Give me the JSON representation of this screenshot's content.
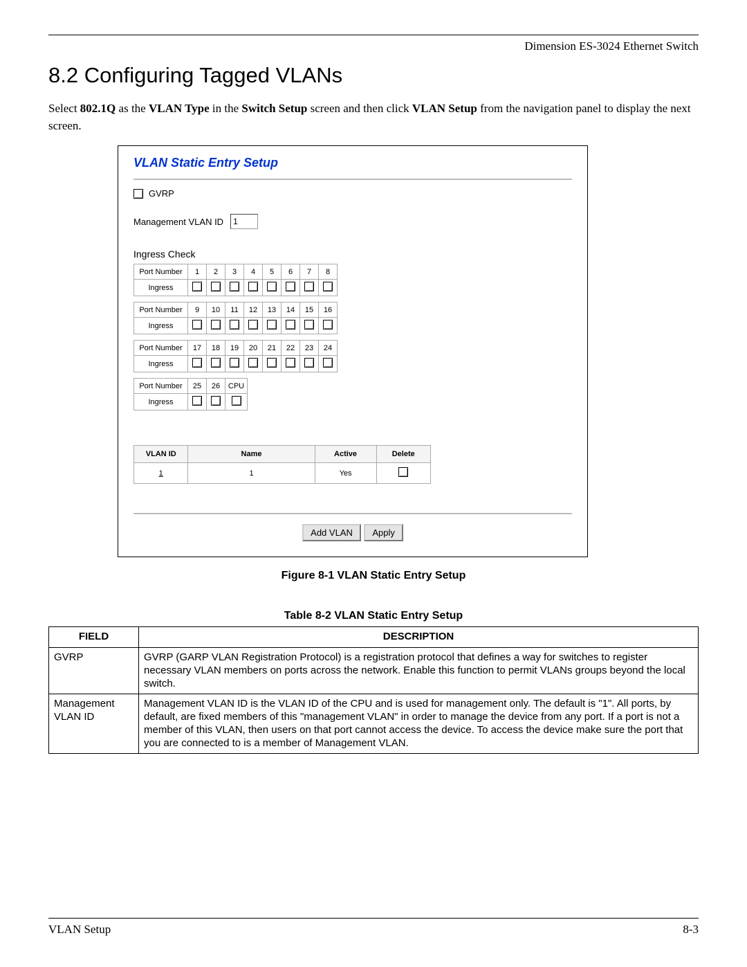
{
  "header": {
    "text": "Dimension ES-3024 Ethernet Switch"
  },
  "heading": "8.2  Configuring Tagged VLANs",
  "paragraph": {
    "pre": "Select ",
    "b1": "802.1Q",
    "mid1": " as the ",
    "b2": "VLAN Type",
    "mid2": " in the ",
    "b3": "Switch Setup",
    "mid3": " screen and then click ",
    "b4": "VLAN Setup",
    "post": " from the navigation panel to display the next screen."
  },
  "figure": {
    "title": "VLAN Static Entry Setup",
    "gvrp_label": "GVRP",
    "mgmt_label": "Management VLAN ID",
    "mgmt_value": "1",
    "ingress_title": "Ingress Check",
    "port_number_label": "Port Number",
    "ingress_label": "Ingress",
    "row1": [
      "1",
      "2",
      "3",
      "4",
      "5",
      "6",
      "7",
      "8"
    ],
    "row2": [
      "9",
      "10",
      "11",
      "12",
      "13",
      "14",
      "15",
      "16"
    ],
    "row3": [
      "17",
      "18",
      "19",
      "20",
      "21",
      "22",
      "23",
      "24"
    ],
    "row4": [
      "25",
      "26",
      "CPU"
    ],
    "vlan_headers": {
      "id": "VLAN ID",
      "name": "Name",
      "active": "Active",
      "delete": "Delete"
    },
    "vlan_row": {
      "id": "1",
      "name": "1",
      "active": "Yes"
    },
    "buttons": {
      "add": "Add VLAN",
      "apply": "Apply"
    }
  },
  "figure_caption": "Figure 8-1 VLAN Static Entry Setup",
  "table_caption": "Table 8-2 VLAN Static Entry Setup",
  "desc_headers": {
    "field": "FIELD",
    "desc": "DESCRIPTION"
  },
  "desc_rows": [
    {
      "field": "GVRP",
      "desc": "GVRP (GARP VLAN Registration Protocol) is a registration protocol that defines a way for switches to register necessary VLAN members on ports across the network. Enable this function to permit VLANs groups beyond the local switch."
    },
    {
      "field": "Management VLAN ID",
      "desc": "Management VLAN ID is the VLAN ID of the CPU and is used for management only. The default is \"1\". All ports, by default, are fixed members of this \"management VLAN\" in order to manage the device from any port. If a port is not a member of this VLAN, then users on that port cannot access the device. To access the device make sure the port that you are connected to is a member of Management VLAN."
    }
  ],
  "footer": {
    "left": "VLAN Setup",
    "right": "8-3"
  }
}
